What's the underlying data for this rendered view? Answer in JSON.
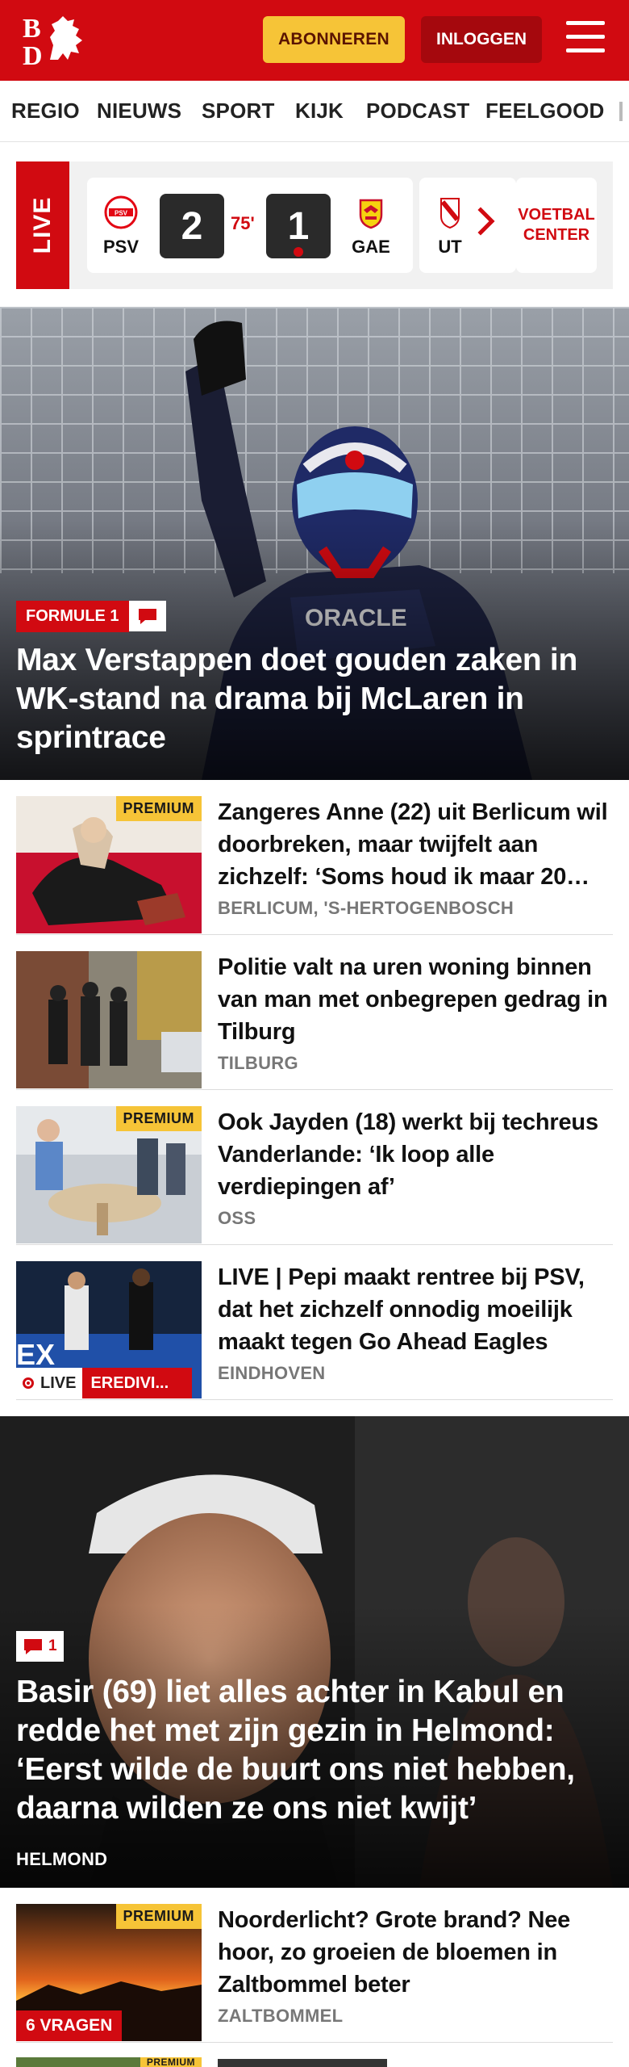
{
  "header": {
    "logo_text": "BD",
    "subscribe_label": "ABONNEREN",
    "login_label": "INLOGGEN",
    "brand_color": "#d10a11"
  },
  "nav": {
    "items": [
      "REGIO",
      "NIEUWS",
      "SPORT",
      "KIJK",
      "PODCAST",
      "FEELGOOD"
    ]
  },
  "live": {
    "label": "LIVE",
    "match": {
      "home": "PSV",
      "away": "GAE",
      "home_score": "2",
      "away_score": "1",
      "minute": "75'"
    },
    "next_team": "UT",
    "center_label_1": "VOETBAL",
    "center_label_2": "CENTER"
  },
  "hero": {
    "tag": "FORMULE 1",
    "title": "Max Verstappen doet gouden zaken in WK-stand na drama bij McLaren in sprintrace"
  },
  "articles": [
    {
      "premium": "PREMIUM",
      "title": "Zangeres Anne (22) uit Berlicum wil doorbreken, maar twijfelt aan zichzelf: ‘Soms houd ik maar 20…",
      "location": "BERLICUM, 'S-HERTOGENBOSCH"
    },
    {
      "title": "Politie valt na uren woning binnen van man met onbegrepen gedrag in Tilburg",
      "location": "TILBURG"
    },
    {
      "premium": "PREMIUM",
      "title": "Ook Jayden (18) werkt bij techreus Vanderlande: ‘Ik loop alle verdiepingen af’",
      "location": "OSS"
    },
    {
      "title": "LIVE | Pepi maakt rentree bij PSV, dat het zichzelf onnodig moeilijk maakt tegen Go Ahead Eagles",
      "location": "EINDHOVEN",
      "live_label": "LIVE",
      "category": "EREDIVI..."
    }
  ],
  "hero2": {
    "comments": "1",
    "title": "Basir (69) liet alles achter in Kabul en redde het met zijn gezin in Helmond: ‘Eerst wilde de buurt ons niet hebben, daarna wilden ze ons niet kwijt’",
    "location": "HELMOND"
  },
  "article_bottom": {
    "premium": "PREMIUM",
    "title": "Noorderlicht? Grote brand? Nee hoor, zo groeien de bloemen in Zaltbommel beter",
    "location": "ZALTBOMMEL",
    "badge": "6 VRAGEN"
  },
  "article_peek": {
    "premium": "PREMIUM"
  }
}
